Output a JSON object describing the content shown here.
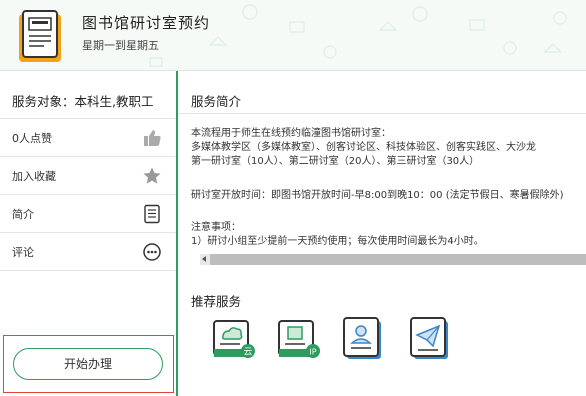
{
  "header": {
    "title": "图书馆研讨室预约",
    "subtitle": "星期一到星期五"
  },
  "sidebar": {
    "audience": "服务对象：本科生,教职工",
    "items": [
      {
        "label": "0人点赞",
        "icon": "thumbs-up-icon"
      },
      {
        "label": "加入收藏",
        "icon": "star-icon"
      },
      {
        "label": "简介",
        "icon": "document-icon"
      },
      {
        "label": "评论",
        "icon": "comment-icon"
      }
    ],
    "start_button": "开始办理"
  },
  "main": {
    "intro_title": "服务简介",
    "intro_lines": [
      "本流程用于师生在线预约临潼图书馆研讨室：",
      "多媒体教学区（多媒体教室）、创客讨论区、科技体验区、创客实践区、大沙龙",
      "第一研讨室（10人）、第二研讨室（20人）、第三研讨室（30人）",
      "研讨室开放时间：即图书馆开放时间-早8:00到晚10：00 (法定节假日、寒暑假除外)",
      "注意事项：",
      "1）研讨小组至少提前一天预约使用；每次使用时间最长为4小时。"
    ],
    "recommended_title": "推荐服务",
    "recommended_services": [
      {
        "icon": "cloud-doc-icon",
        "badge": "云"
      },
      {
        "icon": "ip-doc-icon",
        "badge": "IP"
      },
      {
        "icon": "user-card-icon"
      },
      {
        "icon": "paper-plane-icon"
      }
    ]
  },
  "colors": {
    "accent": "#2e9b5f",
    "highlight_border": "#e0443a",
    "header_bg": "#f5faf7"
  }
}
